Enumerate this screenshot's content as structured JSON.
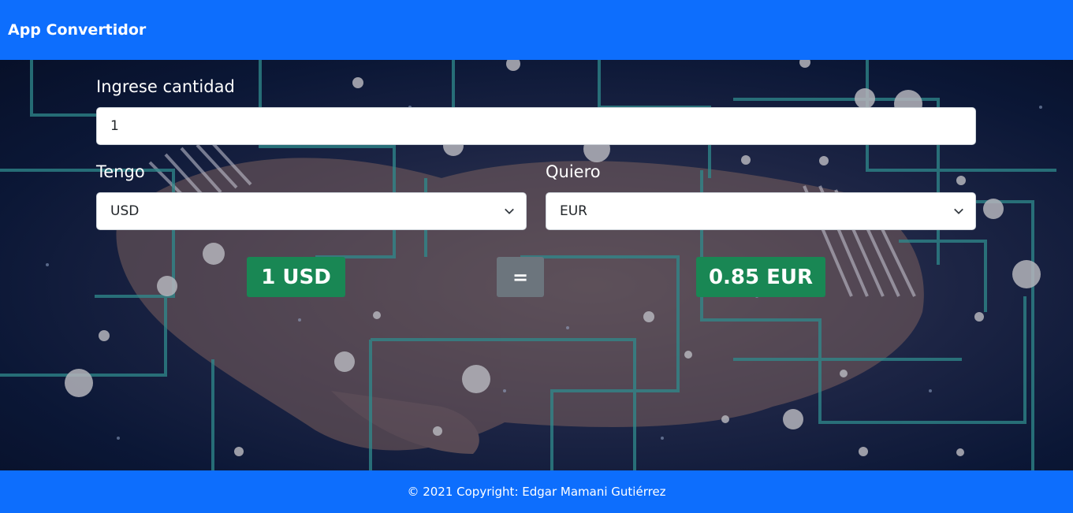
{
  "navbar": {
    "brand": "App Convertidor"
  },
  "form": {
    "amount_label": "Ingrese cantidad",
    "amount_value": "1",
    "from_label": "Tengo",
    "from_value": "USD",
    "to_label": "Quiero",
    "to_value": "EUR"
  },
  "result": {
    "from_text": "1 USD",
    "equals": "=",
    "to_text": "0.85 EUR"
  },
  "footer": {
    "text": "© 2021 Copyright: Edgar Mamani Gutiérrez"
  },
  "colors": {
    "primary": "#0d6efd",
    "success": "#198754",
    "secondary": "#6c757d"
  },
  "icons": {
    "select_chevron": "chevron-down-icon"
  }
}
